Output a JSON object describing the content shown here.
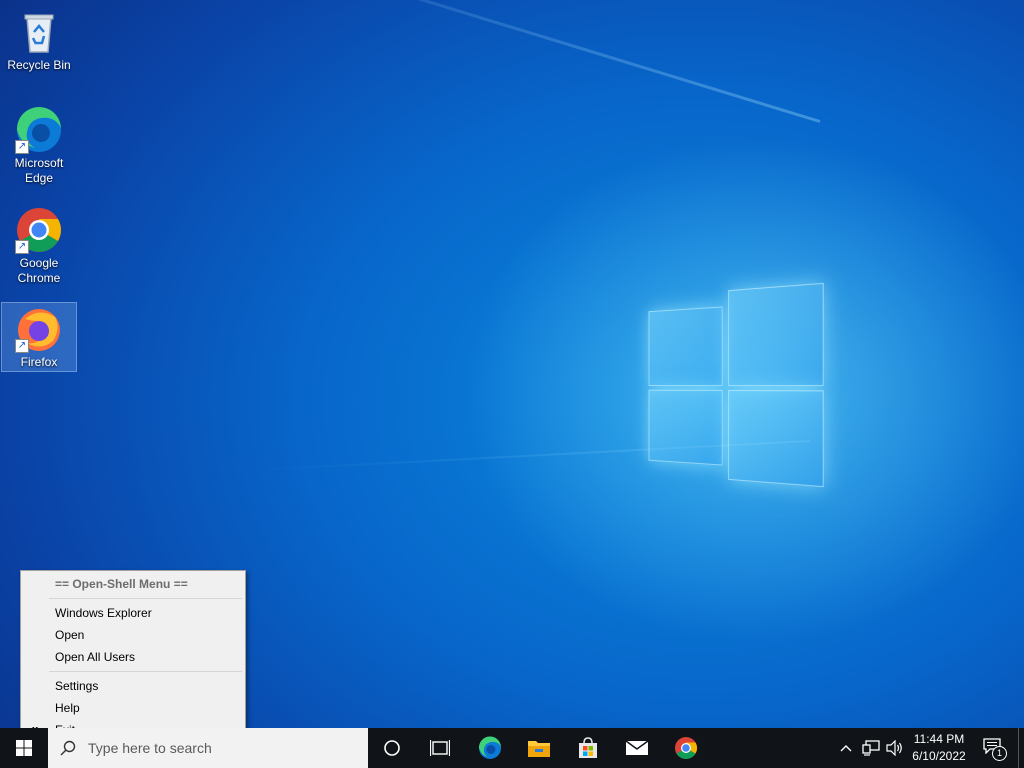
{
  "desktop": {
    "icons": [
      {
        "label": "Recycle Bin",
        "icon": "recycle-bin-icon"
      },
      {
        "label": "Microsoft Edge",
        "icon": "edge-icon"
      },
      {
        "label": "Google Chrome",
        "icon": "chrome-icon"
      },
      {
        "label": "Firefox",
        "icon": "firefox-icon",
        "selected": true
      }
    ]
  },
  "context_menu": {
    "header": "== Open-Shell Menu ==",
    "items": [
      {
        "label": "Windows Explorer"
      },
      {
        "label": "Open"
      },
      {
        "label": "Open All Users"
      },
      {
        "label": "Settings"
      },
      {
        "label": "Help"
      },
      {
        "label": "Exit",
        "mark": "x"
      }
    ]
  },
  "taskbar": {
    "search_placeholder": "Type here to search",
    "pinned": [
      "cortana-icon",
      "task-view-icon",
      "edge-icon",
      "file-explorer-icon",
      "store-icon",
      "mail-icon",
      "chrome-icon"
    ],
    "tray": {
      "time": "11:44 PM",
      "date": "6/10/2022",
      "notification_count": "1"
    }
  },
  "colors": {
    "taskbar_bg": "#101418",
    "menu_bg": "#f0f0f0",
    "desktop_accent": "#0a8be0"
  }
}
